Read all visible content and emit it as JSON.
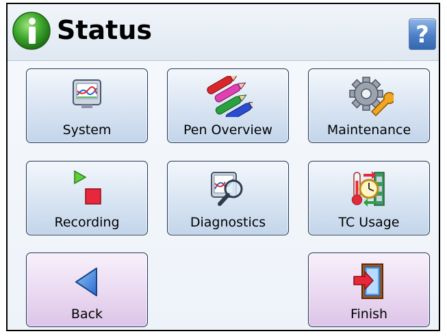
{
  "header": {
    "title": "Status",
    "help_label": "?"
  },
  "tiles": {
    "system": "System",
    "pen_overview": "Pen Overview",
    "maintenance": "Maintenance",
    "recording": "Recording",
    "diagnostics": "Diagnostics",
    "tc_usage": "TC Usage",
    "back": "Back",
    "finish": "Finish"
  },
  "icons": {
    "info": "info-icon",
    "system": "monitor-chart-icon",
    "pen_overview": "pens-icon",
    "maintenance": "gear-wrench-icon",
    "recording": "play-stop-icon",
    "diagnostics": "magnifier-chart-icon",
    "tc_usage": "thermometer-clock-icon",
    "back": "back-arrow-icon",
    "finish": "exit-door-icon"
  },
  "colors": {
    "header_bg": "#e6edf5",
    "tile_bg": "#d8e4f2",
    "nav_tile_bg": "#ead9f1",
    "help_blue": "#4d7fc6",
    "info_green": "#3fa82d"
  }
}
